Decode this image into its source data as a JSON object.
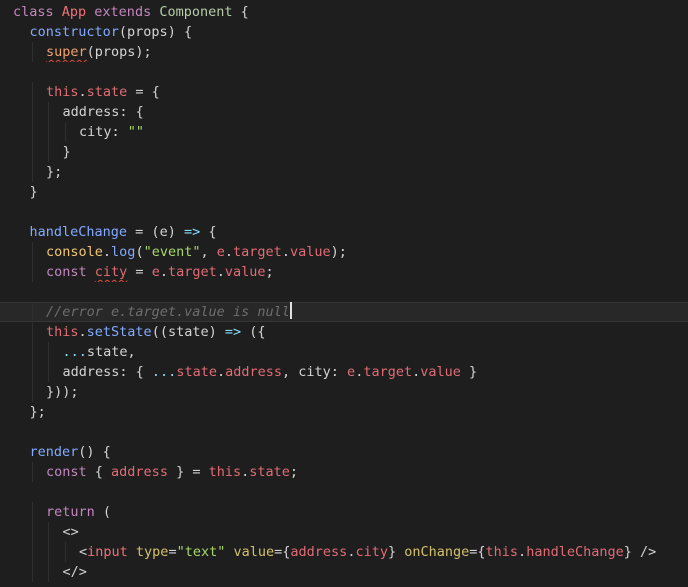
{
  "theme": {
    "background": "#1e1e1e",
    "current_line": "#282828",
    "error_squiggle": "#e04a3c"
  },
  "editor": {
    "lines": [
      {
        "indent": 0,
        "tokens": [
          {
            "t": "class ",
            "k": "keyword"
          },
          {
            "t": "App",
            "k": "class"
          },
          {
            "t": " extends ",
            "k": "keyword"
          },
          {
            "t": "Component",
            "k": "type"
          },
          {
            "t": " {",
            "k": "punct"
          }
        ]
      },
      {
        "indent": 1,
        "tokens": [
          {
            "t": "constructor",
            "k": "func"
          },
          {
            "t": "(",
            "k": "punct"
          },
          {
            "t": "props",
            "k": "param"
          },
          {
            "t": ") {",
            "k": "punct"
          }
        ]
      },
      {
        "indent": 2,
        "tokens": [
          {
            "t": "super",
            "k": "method",
            "squiggle": true
          },
          {
            "t": "(props);",
            "k": "punct"
          }
        ]
      },
      {
        "indent": 0,
        "tokens": []
      },
      {
        "indent": 2,
        "tokens": [
          {
            "t": "this",
            "k": "this"
          },
          {
            "t": ".",
            "k": "punct"
          },
          {
            "t": "state",
            "k": "prop"
          },
          {
            "t": " = {",
            "k": "punct"
          }
        ]
      },
      {
        "indent": 3,
        "tokens": [
          {
            "t": "address",
            "k": "ident"
          },
          {
            "t": ": {",
            "k": "punct"
          }
        ]
      },
      {
        "indent": 4,
        "tokens": [
          {
            "t": "city",
            "k": "ident"
          },
          {
            "t": ": ",
            "k": "punct"
          },
          {
            "t": "\"\"",
            "k": "string"
          }
        ]
      },
      {
        "indent": 3,
        "tokens": [
          {
            "t": "}",
            "k": "punct"
          }
        ]
      },
      {
        "indent": 2,
        "tokens": [
          {
            "t": "};",
            "k": "punct"
          }
        ]
      },
      {
        "indent": 1,
        "tokens": [
          {
            "t": "}",
            "k": "punct"
          }
        ]
      },
      {
        "indent": 0,
        "tokens": []
      },
      {
        "indent": 1,
        "tokens": [
          {
            "t": "handleChange",
            "k": "func"
          },
          {
            "t": " = (",
            "k": "punct"
          },
          {
            "t": "e",
            "k": "param"
          },
          {
            "t": ") ",
            "k": "punct"
          },
          {
            "t": "=>",
            "k": "op"
          },
          {
            "t": " {",
            "k": "punct"
          }
        ]
      },
      {
        "indent": 2,
        "tokens": [
          {
            "t": "console",
            "k": "console"
          },
          {
            "t": ".",
            "k": "punct"
          },
          {
            "t": "log",
            "k": "func"
          },
          {
            "t": "(",
            "k": "punct"
          },
          {
            "t": "\"event\"",
            "k": "string"
          },
          {
            "t": ", ",
            "k": "punct"
          },
          {
            "t": "e",
            "k": "prop"
          },
          {
            "t": ".",
            "k": "punct"
          },
          {
            "t": "target",
            "k": "prop"
          },
          {
            "t": ".",
            "k": "punct"
          },
          {
            "t": "value",
            "k": "prop"
          },
          {
            "t": ");",
            "k": "punct"
          }
        ]
      },
      {
        "indent": 2,
        "tokens": [
          {
            "t": "const ",
            "k": "keyword"
          },
          {
            "t": "city",
            "k": "prop",
            "squiggle": true
          },
          {
            "t": " = ",
            "k": "punct"
          },
          {
            "t": "e",
            "k": "prop"
          },
          {
            "t": ".",
            "k": "punct"
          },
          {
            "t": "target",
            "k": "prop"
          },
          {
            "t": ".",
            "k": "punct"
          },
          {
            "t": "value",
            "k": "prop"
          },
          {
            "t": ";",
            "k": "punct"
          }
        ]
      },
      {
        "indent": 0,
        "tokens": []
      },
      {
        "indent": 2,
        "current": true,
        "cursor": true,
        "tokens": [
          {
            "t": "//error e.target.value is null",
            "k": "comment"
          }
        ]
      },
      {
        "indent": 2,
        "tokens": [
          {
            "t": "this",
            "k": "this"
          },
          {
            "t": ".",
            "k": "punct"
          },
          {
            "t": "setState",
            "k": "func"
          },
          {
            "t": "((",
            "k": "punct"
          },
          {
            "t": "state",
            "k": "param"
          },
          {
            "t": ") ",
            "k": "punct"
          },
          {
            "t": "=>",
            "k": "op"
          },
          {
            "t": " ({",
            "k": "punct"
          }
        ]
      },
      {
        "indent": 3,
        "tokens": [
          {
            "t": "...",
            "k": "spread"
          },
          {
            "t": "state",
            "k": "ident"
          },
          {
            "t": ",",
            "k": "punct"
          }
        ]
      },
      {
        "indent": 3,
        "tokens": [
          {
            "t": "address",
            "k": "ident"
          },
          {
            "t": ": { ",
            "k": "punct"
          },
          {
            "t": "...",
            "k": "spread"
          },
          {
            "t": "state",
            "k": "prop"
          },
          {
            "t": ".",
            "k": "punct"
          },
          {
            "t": "address",
            "k": "prop"
          },
          {
            "t": ", ",
            "k": "punct"
          },
          {
            "t": "city",
            "k": "ident"
          },
          {
            "t": ": ",
            "k": "punct"
          },
          {
            "t": "e",
            "k": "prop"
          },
          {
            "t": ".",
            "k": "punct"
          },
          {
            "t": "target",
            "k": "prop"
          },
          {
            "t": ".",
            "k": "punct"
          },
          {
            "t": "value",
            "k": "prop"
          },
          {
            "t": " }",
            "k": "punct"
          }
        ]
      },
      {
        "indent": 2,
        "tokens": [
          {
            "t": "}));",
            "k": "punct"
          }
        ]
      },
      {
        "indent": 1,
        "tokens": [
          {
            "t": "};",
            "k": "punct"
          }
        ]
      },
      {
        "indent": 0,
        "tokens": []
      },
      {
        "indent": 1,
        "tokens": [
          {
            "t": "render",
            "k": "func"
          },
          {
            "t": "() {",
            "k": "punct"
          }
        ]
      },
      {
        "indent": 2,
        "tokens": [
          {
            "t": "const ",
            "k": "keyword"
          },
          {
            "t": "{ ",
            "k": "punct"
          },
          {
            "t": "address",
            "k": "prop"
          },
          {
            "t": " } = ",
            "k": "punct"
          },
          {
            "t": "this",
            "k": "this"
          },
          {
            "t": ".",
            "k": "punct"
          },
          {
            "t": "state",
            "k": "prop"
          },
          {
            "t": ";",
            "k": "punct"
          }
        ]
      },
      {
        "indent": 0,
        "tokens": []
      },
      {
        "indent": 2,
        "tokens": [
          {
            "t": "return",
            "k": "keyword"
          },
          {
            "t": " (",
            "k": "punct"
          }
        ]
      },
      {
        "indent": 3,
        "tokens": [
          {
            "t": "<>",
            "k": "punct"
          }
        ]
      },
      {
        "indent": 4,
        "tokens": [
          {
            "t": "<",
            "k": "punct"
          },
          {
            "t": "input",
            "k": "tag"
          },
          {
            "t": " ",
            "k": "punct"
          },
          {
            "t": "type",
            "k": "attr"
          },
          {
            "t": "=",
            "k": "punct"
          },
          {
            "t": "\"text\"",
            "k": "string"
          },
          {
            "t": " ",
            "k": "punct"
          },
          {
            "t": "value",
            "k": "attr"
          },
          {
            "t": "={",
            "k": "punct"
          },
          {
            "t": "address",
            "k": "prop"
          },
          {
            "t": ".",
            "k": "punct"
          },
          {
            "t": "city",
            "k": "prop"
          },
          {
            "t": "} ",
            "k": "punct"
          },
          {
            "t": "onChange",
            "k": "attr"
          },
          {
            "t": "={",
            "k": "punct"
          },
          {
            "t": "this",
            "k": "this"
          },
          {
            "t": ".",
            "k": "punct"
          },
          {
            "t": "handleChange",
            "k": "prop"
          },
          {
            "t": "} />",
            "k": "punct"
          }
        ]
      },
      {
        "indent": 3,
        "tokens": [
          {
            "t": "</>",
            "k": "punct"
          }
        ]
      }
    ]
  }
}
